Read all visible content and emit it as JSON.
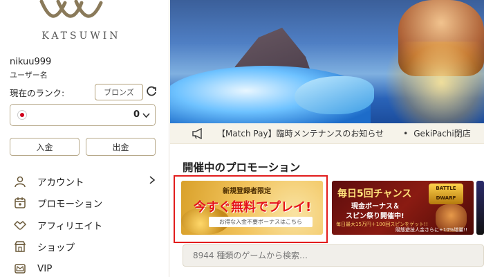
{
  "brand": {
    "name": "KATSUWIN"
  },
  "user": {
    "username": "nikuu999",
    "username_label": "ユーザー名"
  },
  "rank": {
    "label": "現在のランク:",
    "value": "ブロンズ"
  },
  "wallet": {
    "balance": "0",
    "flag": "japan-flag-icon"
  },
  "actions": {
    "deposit": "入金",
    "withdraw": "出金"
  },
  "menu": [
    {
      "label": "アカウント",
      "icon": "user-icon",
      "has_submenu": true
    },
    {
      "label": "プロモーション",
      "icon": "calendar-icon",
      "has_submenu": false
    },
    {
      "label": "アフィリエイト",
      "icon": "handshake-icon",
      "has_submenu": false
    },
    {
      "label": "ショップ",
      "icon": "shop-icon",
      "has_submenu": false
    },
    {
      "label": "VIP",
      "icon": "crown-icon",
      "has_submenu": false
    }
  ],
  "ticker": {
    "items": [
      "【Match Pay】臨時メンテナンスのお知らせ",
      "GekiPachi閉店"
    ]
  },
  "promotions": {
    "heading": "開催中のプロモーション",
    "cards": [
      {
        "subtitle": "新規登録者限定",
        "title": "今すぐ無料でプレイ!",
        "strip": "お得な入金不要ボーナスはこちら",
        "highlighted": true
      },
      {
        "title": "毎日5回チャンス",
        "line1": "現金ボーナス＆",
        "line2": "スピン祭り開催中!",
        "small": "毎日最大15万円＋100回スピンをゲット!!",
        "badge": "BATTLE DWARF",
        "footer": "賦態遊技人金さらに+10%増量!!"
      }
    ]
  },
  "search": {
    "placeholder": "8944 種類のゲームから検索…"
  },
  "colors": {
    "accent_gold": "#b4a27c",
    "highlight_red": "#e21c1c",
    "ticker_bg": "#f6f3ea"
  }
}
